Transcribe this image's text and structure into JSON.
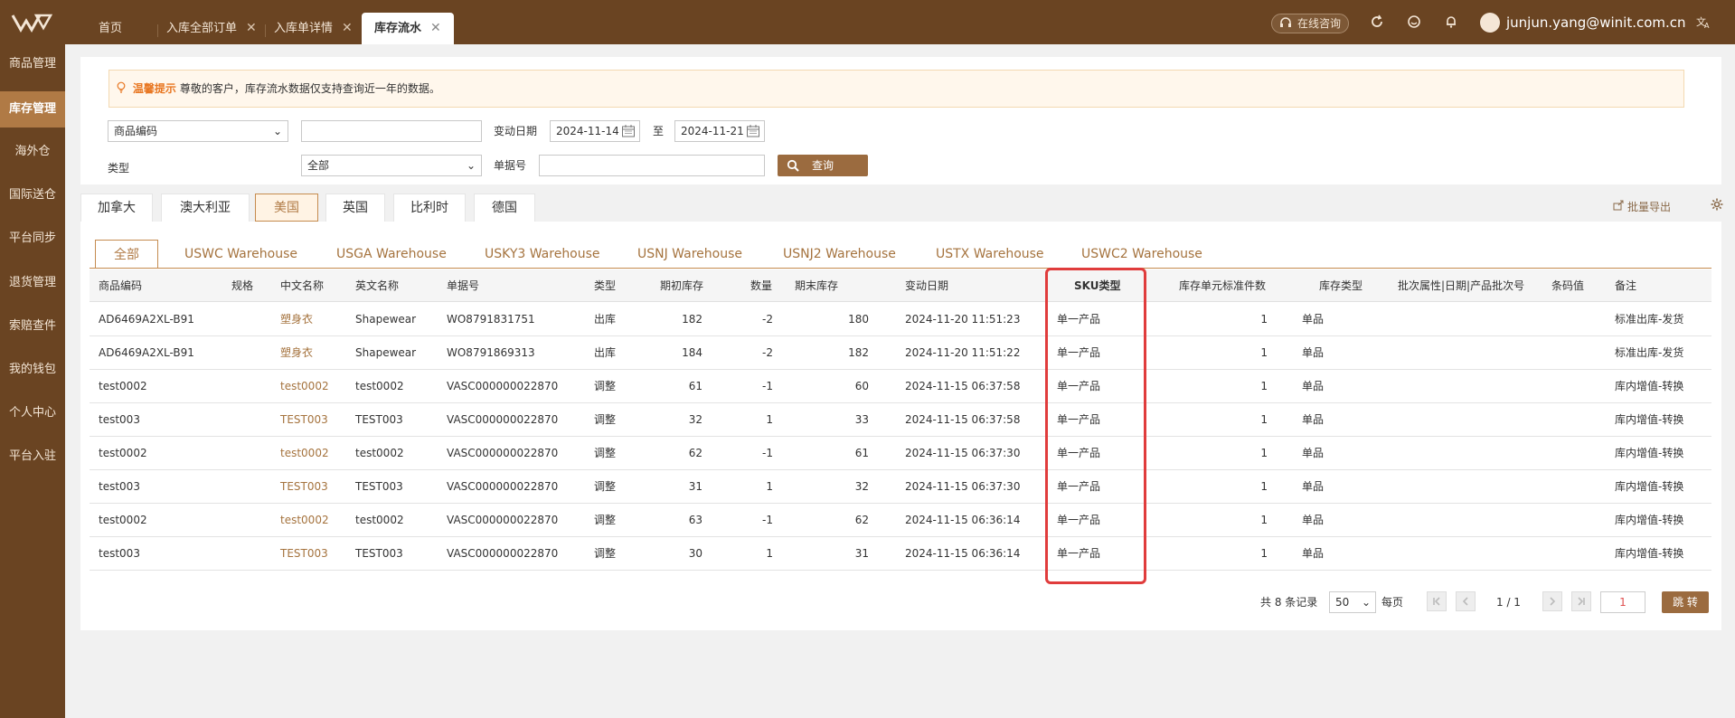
{
  "header": {
    "tabs": [
      {
        "label": "首页"
      },
      {
        "label": "入库全部订单"
      },
      {
        "label": "入库单详情"
      },
      {
        "label": "库存流水"
      }
    ],
    "consult_label": "在线咨询",
    "user_email": "junjun.yang@winit.com.cn"
  },
  "sidebar": {
    "items": [
      {
        "label": "商品管理"
      },
      {
        "label": "库存管理"
      },
      {
        "label": "海外仓"
      },
      {
        "label": "国际送仓"
      },
      {
        "label": "平台同步"
      },
      {
        "label": "退货管理"
      },
      {
        "label": "索赔查件"
      },
      {
        "label": "我的钱包"
      },
      {
        "label": "个人中心"
      },
      {
        "label": "平台入驻"
      }
    ]
  },
  "tip": {
    "title": "温馨提示",
    "text": "尊敬的客户，库存流水数据仅支持查询近一年的数据。"
  },
  "filters": {
    "code_select": "商品编码",
    "code_value": "",
    "date_label": "变动日期",
    "date_from": "2024-11-14",
    "date_to_sep": "至",
    "date_to": "2024-11-21",
    "type_label": "类型",
    "type_select": "全部",
    "doc_label": "单据号",
    "doc_value": "",
    "query_label": "查询"
  },
  "country_tabs": [
    {
      "label": "加拿大"
    },
    {
      "label": "澳大利亚"
    },
    {
      "label": "美国"
    },
    {
      "label": "英国"
    },
    {
      "label": "比利时"
    },
    {
      "label": "德国"
    }
  ],
  "export_label": "批量导出",
  "warehouse_tabs": [
    {
      "label": "全部"
    },
    {
      "label": "USWC Warehouse"
    },
    {
      "label": "USGA Warehouse"
    },
    {
      "label": "USKY3 Warehouse"
    },
    {
      "label": "USNJ Warehouse"
    },
    {
      "label": "USNJ2 Warehouse"
    },
    {
      "label": "USTX Warehouse"
    },
    {
      "label": "USWC2 Warehouse"
    }
  ],
  "table": {
    "headers": {
      "code": "商品编码",
      "spec": "规格",
      "cn_name": "中文名称",
      "en_name": "英文名称",
      "doc_no": "单据号",
      "type": "类型",
      "open_stock": "期初库存",
      "qty": "数量",
      "close_stock": "期末库存",
      "date": "变动日期",
      "sku_type": "SKU类型",
      "unit_std": "库存单元标准件数",
      "stock_type": "库存类型",
      "batch": "批次属性|日期|产品批次号",
      "barcode": "条码值",
      "remark": "备注"
    },
    "rows": [
      {
        "code": "AD6469A2XL-B91",
        "spec": "",
        "cn_name": "塑身衣",
        "en_name": "Shapewear",
        "doc_no": "WO8791831751",
        "type": "出库",
        "open_stock": "182",
        "qty": "-2",
        "close_stock": "180",
        "date": "2024-11-20 11:51:23",
        "sku_type": "单一产品",
        "unit_std": "1",
        "stock_type": "单品",
        "batch": "",
        "barcode": "",
        "remark": "标准出库-发货"
      },
      {
        "code": "AD6469A2XL-B91",
        "spec": "",
        "cn_name": "塑身衣",
        "en_name": "Shapewear",
        "doc_no": "WO8791869313",
        "type": "出库",
        "open_stock": "184",
        "qty": "-2",
        "close_stock": "182",
        "date": "2024-11-20 11:51:22",
        "sku_type": "单一产品",
        "unit_std": "1",
        "stock_type": "单品",
        "batch": "",
        "barcode": "",
        "remark": "标准出库-发货"
      },
      {
        "code": "test0002",
        "spec": "",
        "cn_name": "test0002",
        "en_name": "test0002",
        "doc_no": "VASC000000022870",
        "type": "调整",
        "open_stock": "61",
        "qty": "-1",
        "close_stock": "60",
        "date": "2024-11-15 06:37:58",
        "sku_type": "单一产品",
        "unit_std": "1",
        "stock_type": "单品",
        "batch": "",
        "barcode": "",
        "remark": "库内增值-转换"
      },
      {
        "code": "test003",
        "spec": "",
        "cn_name": "TEST003",
        "en_name": "TEST003",
        "doc_no": "VASC000000022870",
        "type": "调整",
        "open_stock": "32",
        "qty": "1",
        "close_stock": "33",
        "date": "2024-11-15 06:37:58",
        "sku_type": "单一产品",
        "unit_std": "1",
        "stock_type": "单品",
        "batch": "",
        "barcode": "",
        "remark": "库内增值-转换"
      },
      {
        "code": "test0002",
        "spec": "",
        "cn_name": "test0002",
        "en_name": "test0002",
        "doc_no": "VASC000000022870",
        "type": "调整",
        "open_stock": "62",
        "qty": "-1",
        "close_stock": "61",
        "date": "2024-11-15 06:37:30",
        "sku_type": "单一产品",
        "unit_std": "1",
        "stock_type": "单品",
        "batch": "",
        "barcode": "",
        "remark": "库内增值-转换"
      },
      {
        "code": "test003",
        "spec": "",
        "cn_name": "TEST003",
        "en_name": "TEST003",
        "doc_no": "VASC000000022870",
        "type": "调整",
        "open_stock": "31",
        "qty": "1",
        "close_stock": "32",
        "date": "2024-11-15 06:37:30",
        "sku_type": "单一产品",
        "unit_std": "1",
        "stock_type": "单品",
        "batch": "",
        "barcode": "",
        "remark": "库内增值-转换"
      },
      {
        "code": "test0002",
        "spec": "",
        "cn_name": "test0002",
        "en_name": "test0002",
        "doc_no": "VASC000000022870",
        "type": "调整",
        "open_stock": "63",
        "qty": "-1",
        "close_stock": "62",
        "date": "2024-11-15 06:36:14",
        "sku_type": "单一产品",
        "unit_std": "1",
        "stock_type": "单品",
        "batch": "",
        "barcode": "",
        "remark": "库内增值-转换"
      },
      {
        "code": "test003",
        "spec": "",
        "cn_name": "TEST003",
        "en_name": "TEST003",
        "doc_no": "VASC000000022870",
        "type": "调整",
        "open_stock": "30",
        "qty": "1",
        "close_stock": "31",
        "date": "2024-11-15 06:36:14",
        "sku_type": "单一产品",
        "unit_std": "1",
        "stock_type": "单品",
        "batch": "",
        "barcode": "",
        "remark": "库内增值-转换"
      }
    ]
  },
  "pagination": {
    "total_text": "共 8 条记录",
    "page_size": "50",
    "per_page_label": "每页",
    "page_info": "1 / 1",
    "goto_value": "1",
    "jump_label": "跳 转"
  },
  "colors": {
    "brand": "#6a4422",
    "accent": "#b07a45",
    "highlight": "#e03c3c"
  }
}
